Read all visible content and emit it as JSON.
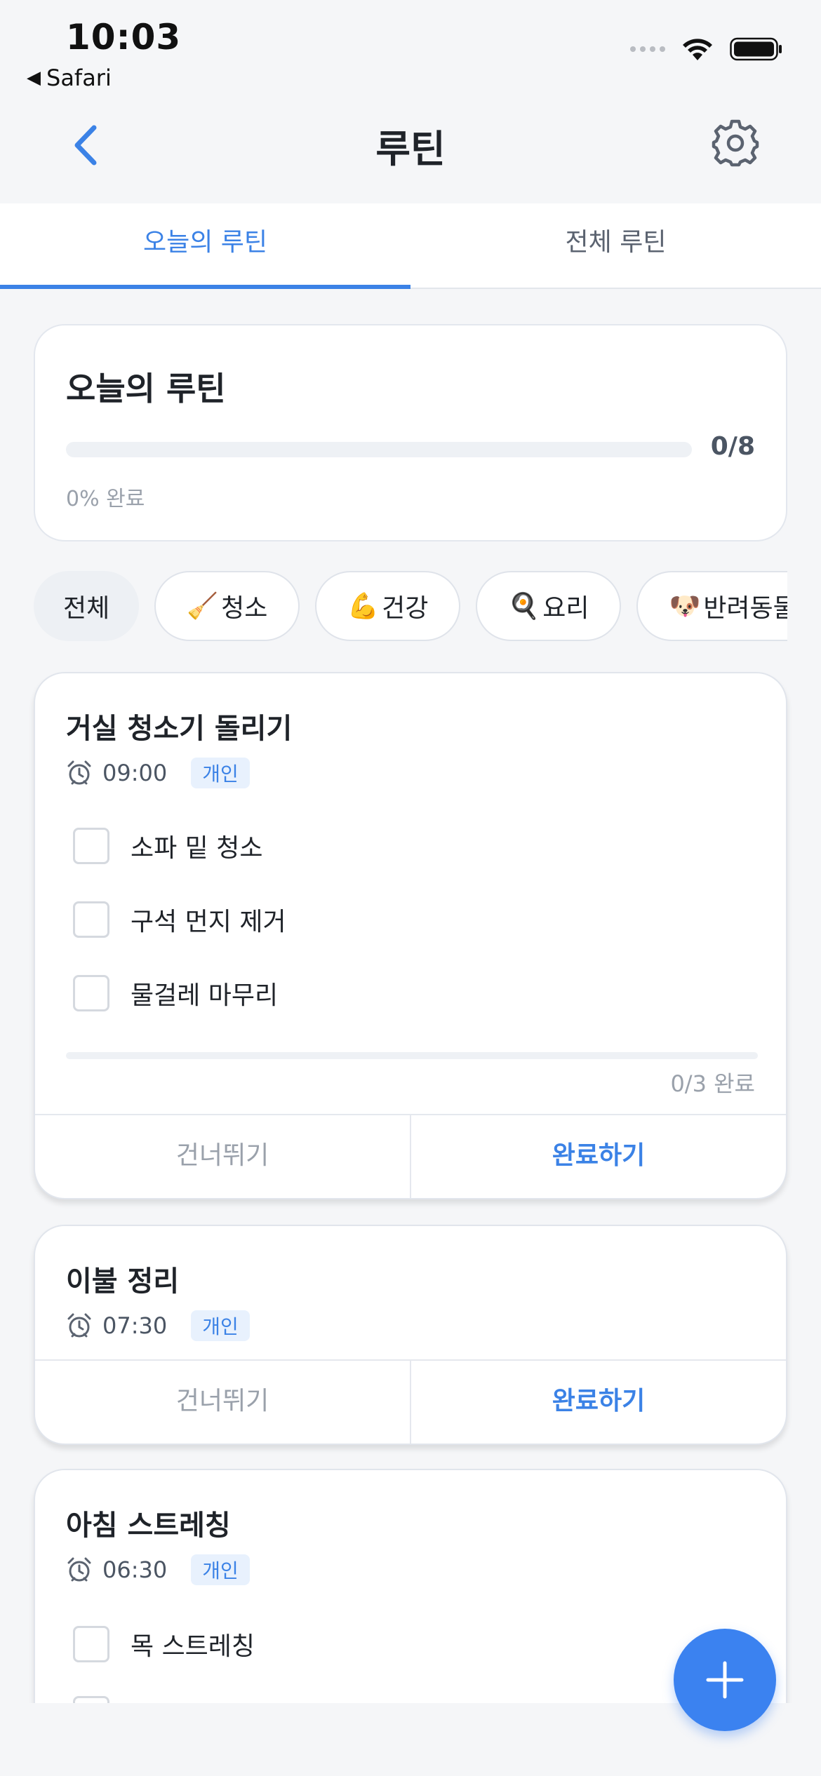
{
  "status_bar": {
    "time": "10:03",
    "back_app": "Safari"
  },
  "nav": {
    "title": "루틴"
  },
  "tabs": [
    {
      "label": "오늘의 루틴",
      "active": true
    },
    {
      "label": "전체 루틴",
      "active": false
    }
  ],
  "summary": {
    "title": "오늘의 루틴",
    "progress_count": "0/8",
    "progress_fraction": 0,
    "percent_text": "0% 완료"
  },
  "filters": [
    {
      "emoji": "",
      "label": "전체",
      "active": true
    },
    {
      "emoji": "🧹",
      "label": "청소",
      "active": false
    },
    {
      "emoji": "💪",
      "label": "건강",
      "active": false
    },
    {
      "emoji": "🍳",
      "label": "요리",
      "active": false
    },
    {
      "emoji": "🐶",
      "label": "반려동물",
      "active": false
    }
  ],
  "routines": [
    {
      "title": "거실 청소기 돌리기",
      "time": "09:00",
      "tag": "개인",
      "items": [
        "소파 밑 청소",
        "구석 먼지 제거",
        "물걸레 마무리"
      ],
      "progress_fraction": 0,
      "progress_text": "0/3 완료",
      "skip_label": "건너뛰기",
      "done_label": "완료하기"
    },
    {
      "title": "이불 정리",
      "time": "07:30",
      "tag": "개인",
      "items": [],
      "skip_label": "건너뛰기",
      "done_label": "완료하기"
    },
    {
      "title": "아침 스트레칭",
      "time": "06:30",
      "tag": "개인",
      "items": [
        "목 스트레칭"
      ]
    }
  ],
  "colors": {
    "accent": "#3b82e6",
    "muted": "#9aa1ab",
    "background": "#f5f6f8"
  },
  "icons": {
    "back": "chevron-left-icon",
    "settings": "gear-icon",
    "alarm": "alarm-clock-icon",
    "add": "plus-icon"
  }
}
